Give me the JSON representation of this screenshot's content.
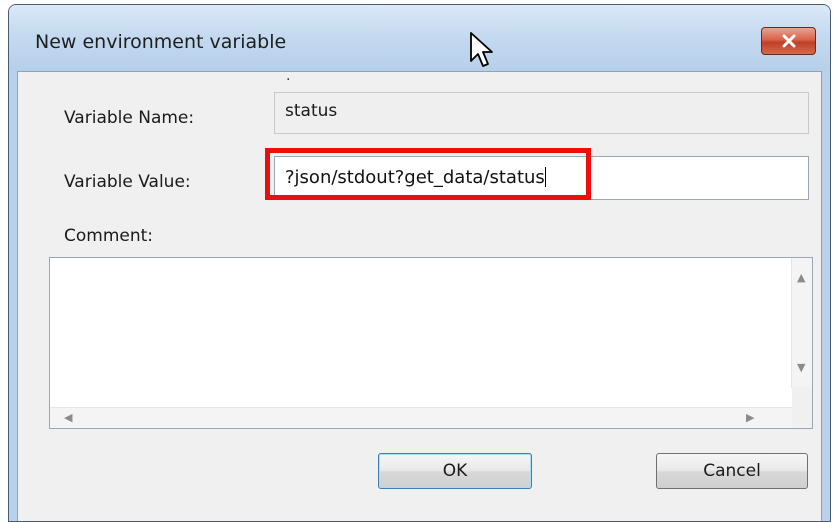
{
  "window": {
    "title": "New environment variable",
    "close_icon": "close-icon"
  },
  "form": {
    "name_label": "Variable Name:",
    "name_value": "status",
    "value_label": "Variable Value:",
    "value_value": "?json/stdout?get_data/status",
    "comment_label": "Comment:",
    "comment_value": ""
  },
  "buttons": {
    "ok": "OK",
    "cancel": "Cancel"
  },
  "colors": {
    "highlight": "#ee0d0d",
    "titlebar": "#c5daf0",
    "close_button": "#c13f26"
  }
}
